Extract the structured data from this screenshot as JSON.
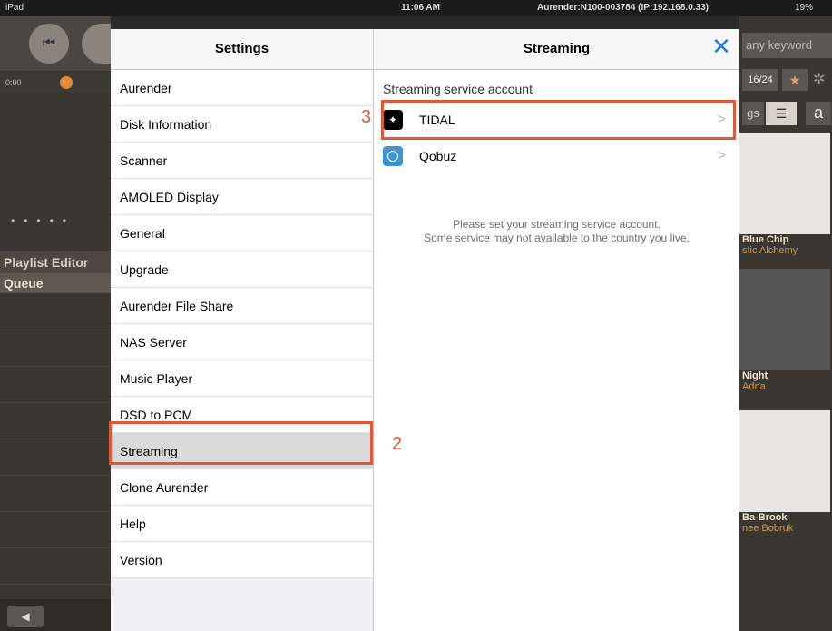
{
  "statusbar": {
    "device": "iPad",
    "time": "11:06 AM",
    "device_name": "Aurender:N100-003784 (IP:192.168.0.33)",
    "battery": "19%"
  },
  "background_app": {
    "elapsed": "0:00",
    "sidebar": {
      "playlist_editor": "Playlist Editor",
      "queue": "Queue"
    },
    "search_placeholder": "any keyword",
    "count": "16/24",
    "tags_tab": "gs",
    "alpha_tab": "a",
    "albums": [
      {
        "title": "Blue Chip",
        "artist": "stic Alchemy"
      },
      {
        "title": "Night",
        "artist": "Adna"
      },
      {
        "title": "Ba-Brook",
        "artist": "nee Bobruk"
      }
    ]
  },
  "settings": {
    "title": "Settings",
    "items": [
      "Aurender",
      "Disk Information",
      "Scanner",
      "AMOLED Display",
      "General",
      "Upgrade",
      "Aurender File Share",
      "NAS Server",
      "Music Player",
      "DSD to PCM",
      "Streaming",
      "Clone Aurender",
      "Help",
      "Version"
    ],
    "selected": "Streaming"
  },
  "streaming": {
    "title": "Streaming",
    "section_title": "Streaming service account",
    "services": [
      {
        "name": "TIDAL",
        "icon": "tidal-icon"
      },
      {
        "name": "Qobuz",
        "icon": "qobuz-icon"
      }
    ],
    "hint_line1": "Please set your streaming service account.",
    "hint_line2": "Some service may not available to the country you live."
  },
  "annotations": {
    "step2": "2",
    "step3": "3",
    "color": "#e2563a"
  }
}
